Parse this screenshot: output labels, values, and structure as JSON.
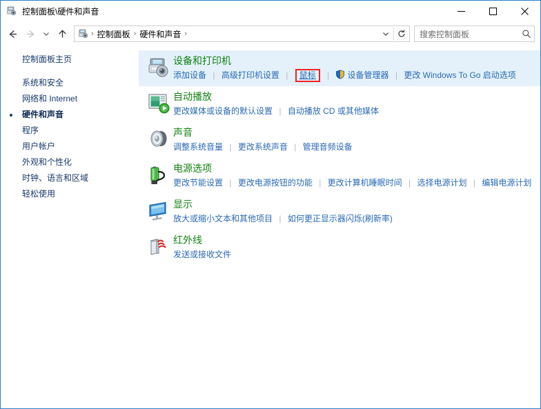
{
  "window": {
    "title": "控制面板\\硬件和声音",
    "icon": "devices-printers-icon",
    "minimize_label": "最小化",
    "maximize_label": "最大化",
    "close_label": "关闭"
  },
  "toolbar": {
    "back_label": "后退",
    "forward_label": "前进",
    "recent_label": "最近浏览的位置",
    "up_label": "向上",
    "refresh_label": "刷新",
    "dropdown_label": "展开",
    "breadcrumbs": [
      "控制面板",
      "硬件和声音"
    ],
    "separator": "›"
  },
  "search": {
    "placeholder": "搜索控制面板",
    "icon": "search-icon"
  },
  "sidebar": {
    "home": "控制面板主页",
    "items": [
      {
        "label": "系统和安全",
        "selected": false
      },
      {
        "label": "网络和 Internet",
        "selected": false
      },
      {
        "label": "硬件和声音",
        "selected": true
      },
      {
        "label": "程序",
        "selected": false
      },
      {
        "label": "用户帐户",
        "selected": false
      },
      {
        "label": "外观和个性化",
        "selected": false
      },
      {
        "label": "时钟、语言和区域",
        "selected": false
      },
      {
        "label": "轻松使用",
        "selected": false
      }
    ]
  },
  "colors": {
    "heading_green": "#10820f",
    "link_blue": "#2b6ab5",
    "highlight_bg": "#e4f1fb",
    "focus_red": "#f0231b",
    "window_border": "#2a7fc9"
  },
  "sections": [
    {
      "title": "设备和打印机",
      "icon": "devices-printers-icon",
      "highlighted": true,
      "links": [
        {
          "label": "添加设备",
          "shield": false,
          "focused": false
        },
        {
          "label": "高级打印机设置",
          "shield": false,
          "focused": false
        },
        {
          "label": "鼠标",
          "shield": false,
          "focused": true
        },
        {
          "label": "设备管理器",
          "shield": true,
          "focused": false
        },
        {
          "label": "更改 Windows To Go 启动选项",
          "shield": false,
          "focused": false
        }
      ]
    },
    {
      "title": "自动播放",
      "icon": "autoplay-icon",
      "highlighted": false,
      "links": [
        {
          "label": "更改媒体或设备的默认设置",
          "shield": false,
          "focused": false
        },
        {
          "label": "自动播放 CD 或其他媒体",
          "shield": false,
          "focused": false
        }
      ]
    },
    {
      "title": "声音",
      "icon": "sound-icon",
      "highlighted": false,
      "links": [
        {
          "label": "调整系统音量",
          "shield": false,
          "focused": false
        },
        {
          "label": "更改系统声音",
          "shield": false,
          "focused": false
        },
        {
          "label": "管理音频设备",
          "shield": false,
          "focused": false
        }
      ]
    },
    {
      "title": "电源选项",
      "icon": "power-options-icon",
      "highlighted": false,
      "links": [
        {
          "label": "更改节能设置",
          "shield": false,
          "focused": false
        },
        {
          "label": "更改电源按钮的功能",
          "shield": false,
          "focused": false
        },
        {
          "label": "更改计算机睡眠时间",
          "shield": false,
          "focused": false
        },
        {
          "label": "选择电源计划",
          "shield": false,
          "focused": false
        },
        {
          "label": "编辑电源计划",
          "shield": false,
          "focused": false
        }
      ]
    },
    {
      "title": "显示",
      "icon": "display-icon",
      "highlighted": false,
      "links": [
        {
          "label": "放大或缩小文本和其他项目",
          "shield": false,
          "focused": false
        },
        {
          "label": "如何更正显示器闪烁(刷新率)",
          "shield": false,
          "focused": false
        }
      ]
    },
    {
      "title": "红外线",
      "icon": "infrared-icon",
      "highlighted": false,
      "links": [
        {
          "label": "发送或接收文件",
          "shield": false,
          "focused": false
        }
      ]
    }
  ]
}
